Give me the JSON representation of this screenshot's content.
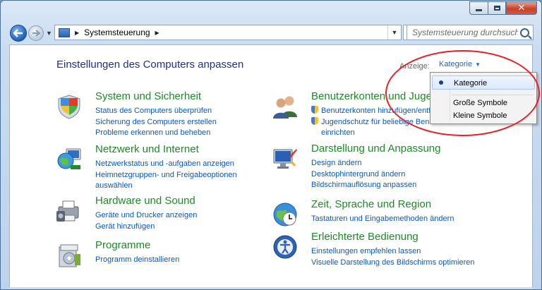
{
  "window": {
    "breadcrumb": "Systemsteuerung",
    "search_placeholder": "Systemsteuerung durchsuchen"
  },
  "page": {
    "title": "Einstellungen des Computers anpassen",
    "view_label": "Anzeige:",
    "view_value": "Kategorie"
  },
  "categories": [
    {
      "title": "System und Sicherheit",
      "links": [
        "Status des Computers überprüfen",
        "Sicherung des Computers erstellen",
        "Probleme erkennen und beheben"
      ]
    },
    {
      "title": "Netzwerk und Internet",
      "links": [
        "Netzwerkstatus und -aufgaben anzeigen",
        "Heimnetzgruppen- und Freigabeoptionen",
        "auswählen"
      ]
    },
    {
      "title": "Hardware und Sound",
      "links": [
        "Geräte und Drucker anzeigen",
        "Gerät hinzufügen"
      ]
    },
    {
      "title": "Programme",
      "links": [
        "Programm deinstallieren"
      ]
    },
    {
      "title": "Benutzerkonten und Jugendschutz",
      "links": [
        "Benutzerkonten hinzufügen/entfernen",
        "Jugendschutz für beliebige Benutzer",
        "einrichten"
      ]
    },
    {
      "title": "Darstellung und Anpassung",
      "links": [
        "Design ändern",
        "Desktophintergrund ändern",
        "Bildschirmauflösung anpassen"
      ]
    },
    {
      "title": "Zeit, Sprache und Region",
      "links": [
        "Tastaturen und Eingabemethoden ändern"
      ]
    },
    {
      "title": "Erleichterte Bedienung",
      "links": [
        "Einstellungen empfehlen lassen",
        "Visuelle Darstellung des Bildschirms optimieren"
      ]
    }
  ],
  "view_menu": {
    "items": [
      "Kategorie",
      "Große Symbole",
      "Kleine Symbole"
    ],
    "selected": "Kategorie"
  },
  "colors": {
    "link": "#0d59bd",
    "category_title": "#1e8a27",
    "annotation": "#e8202a"
  }
}
